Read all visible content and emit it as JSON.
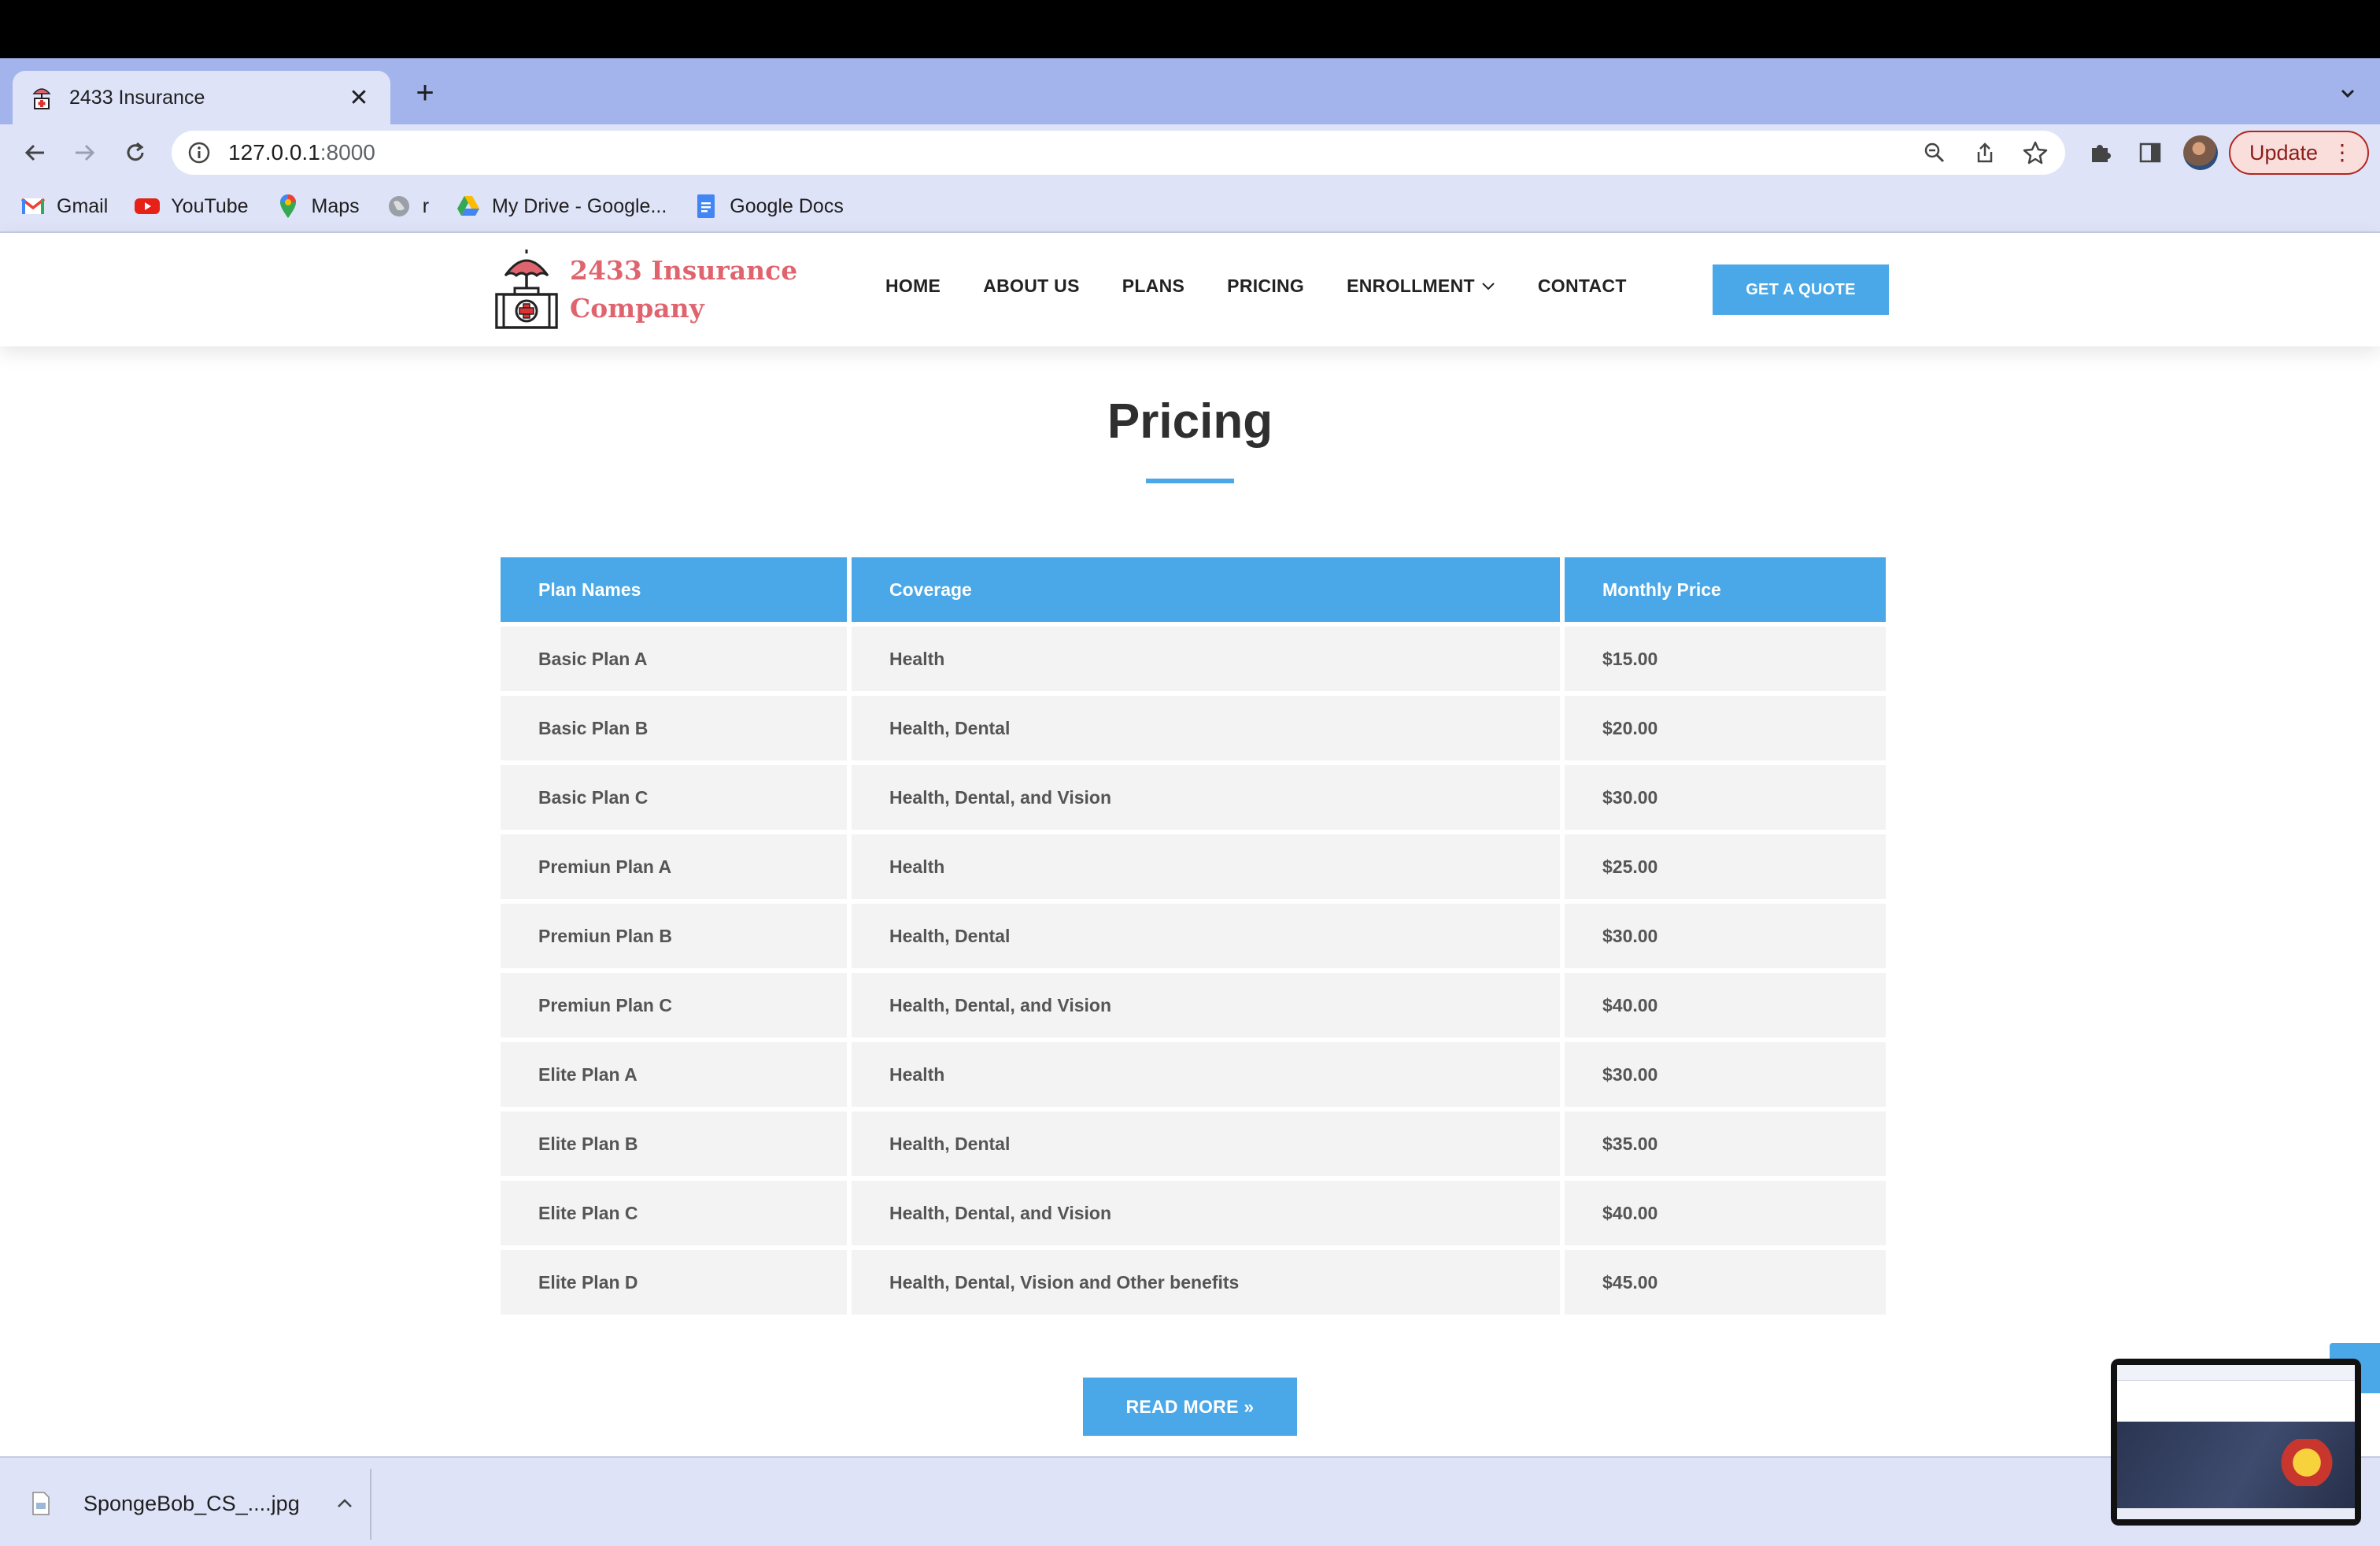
{
  "browser": {
    "tab_title": "2433 Insurance",
    "url_host": "127.0.0.1",
    "url_port": ":8000",
    "update_label": "Update",
    "bookmarks": [
      {
        "label": "Gmail",
        "icon": "gmail-icon"
      },
      {
        "label": "YouTube",
        "icon": "youtube-icon"
      },
      {
        "label": "Maps",
        "icon": "maps-icon"
      },
      {
        "label": "r",
        "icon": "globe-icon"
      },
      {
        "label": "My Drive - Google...",
        "icon": "google-drive-icon"
      },
      {
        "label": "Google Docs",
        "icon": "google-docs-icon"
      }
    ]
  },
  "site": {
    "logo_line1": "2433 Insurance",
    "logo_line2": "Company",
    "nav": [
      "HOME",
      "ABOUT US",
      "PLANS",
      "PRICING",
      "ENROLLMENT",
      "CONTACT"
    ],
    "quote_button": "GET A QUOTE",
    "accent_color": "#4aa8e8",
    "logo_color": "#e0646e"
  },
  "main": {
    "title": "Pricing",
    "table": {
      "headers": [
        "Plan Names",
        "Coverage",
        "Monthly Price"
      ],
      "rows": [
        [
          "Basic Plan A",
          "Health",
          "$15.00"
        ],
        [
          "Basic Plan B",
          "Health, Dental",
          "$20.00"
        ],
        [
          "Basic Plan C",
          "Health, Dental, and Vision",
          "$30.00"
        ],
        [
          "Premiun Plan A",
          "Health",
          "$25.00"
        ],
        [
          "Premiun Plan B",
          "Health, Dental",
          "$30.00"
        ],
        [
          "Premiun Plan C",
          "Health, Dental, and Vision",
          "$40.00"
        ],
        [
          "Elite Plan A",
          "Health",
          "$30.00"
        ],
        [
          "Elite Plan B",
          "Health, Dental",
          "$35.00"
        ],
        [
          "Elite Plan C",
          "Health, Dental, and Vision",
          "$40.00"
        ],
        [
          "Elite Plan D",
          "Health, Dental, Vision and Other benefits",
          "$45.00"
        ]
      ]
    },
    "read_more": "READ MORE »"
  },
  "downloads": {
    "file_name": "SpongeBob_CS_....jpg"
  }
}
